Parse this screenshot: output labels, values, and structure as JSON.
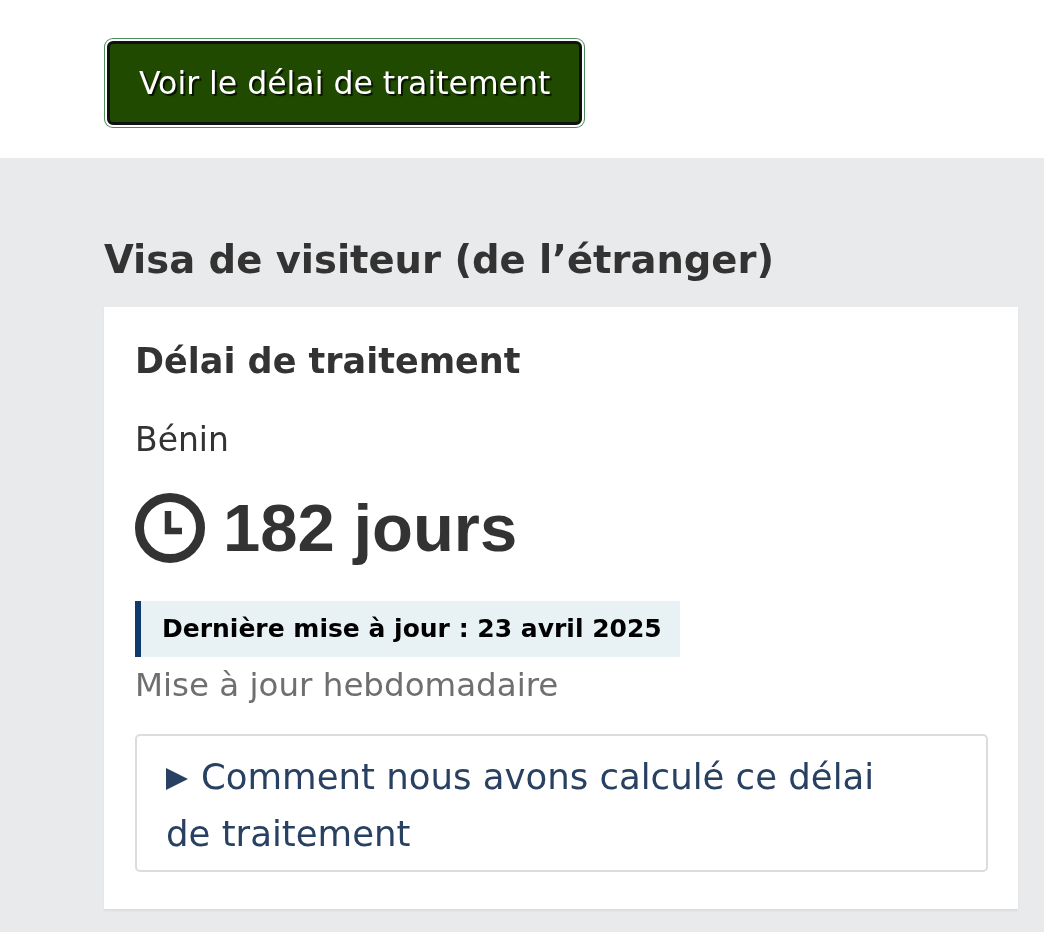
{
  "action_button": {
    "label": "Voir le délai de traitement",
    "focused": true
  },
  "section": {
    "title": "Visa de visiteur (de l’étranger)",
    "card": {
      "title": "Délai de traitement",
      "country": "Bénin",
      "processing_time": "182 jours",
      "last_updated": "Dernière mise à jour : 23 avril 2025",
      "update_frequency": "Mise à jour hebdomadaire",
      "details": {
        "summary": "Comment nous avons calculé ce délai de traitement",
        "expanded": false
      }
    }
  }
}
